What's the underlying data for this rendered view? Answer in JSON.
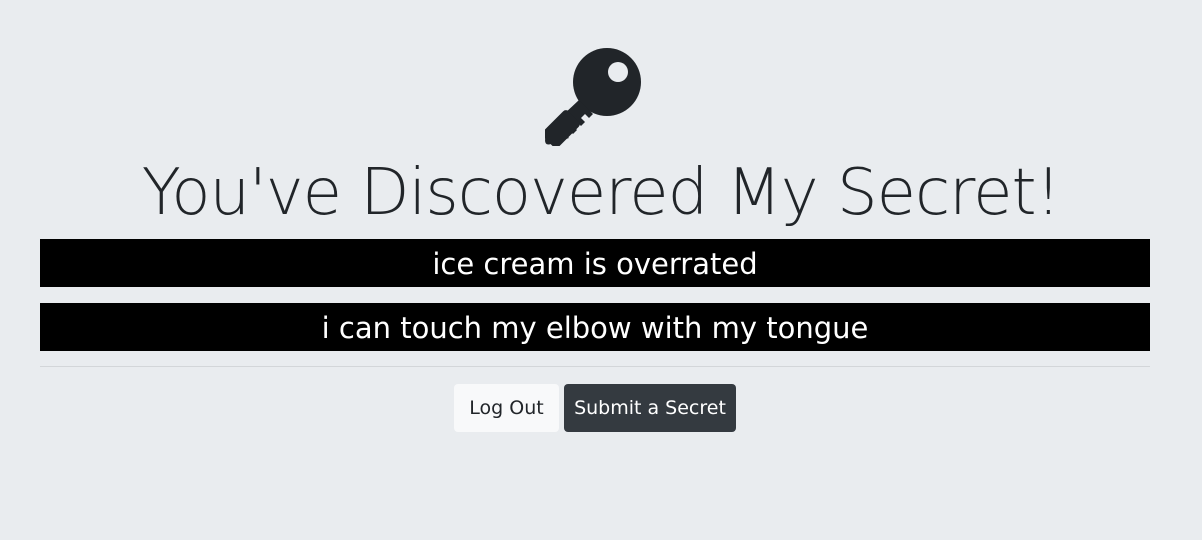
{
  "icons": {
    "hero": "key-icon"
  },
  "colors": {
    "background": "#e9ecef",
    "text": "#212529",
    "secret_bg": "#000000",
    "secret_text": "#ffffff",
    "light_button": "#f8f9fa",
    "dark_button": "#343a40"
  },
  "header": {
    "title": "You've Discovered My Secret!"
  },
  "secrets": [
    "ice cream is overrated",
    "i can touch my elbow with my tongue"
  ],
  "actions": {
    "logout_label": "Log Out",
    "submit_label": "Submit a Secret"
  }
}
